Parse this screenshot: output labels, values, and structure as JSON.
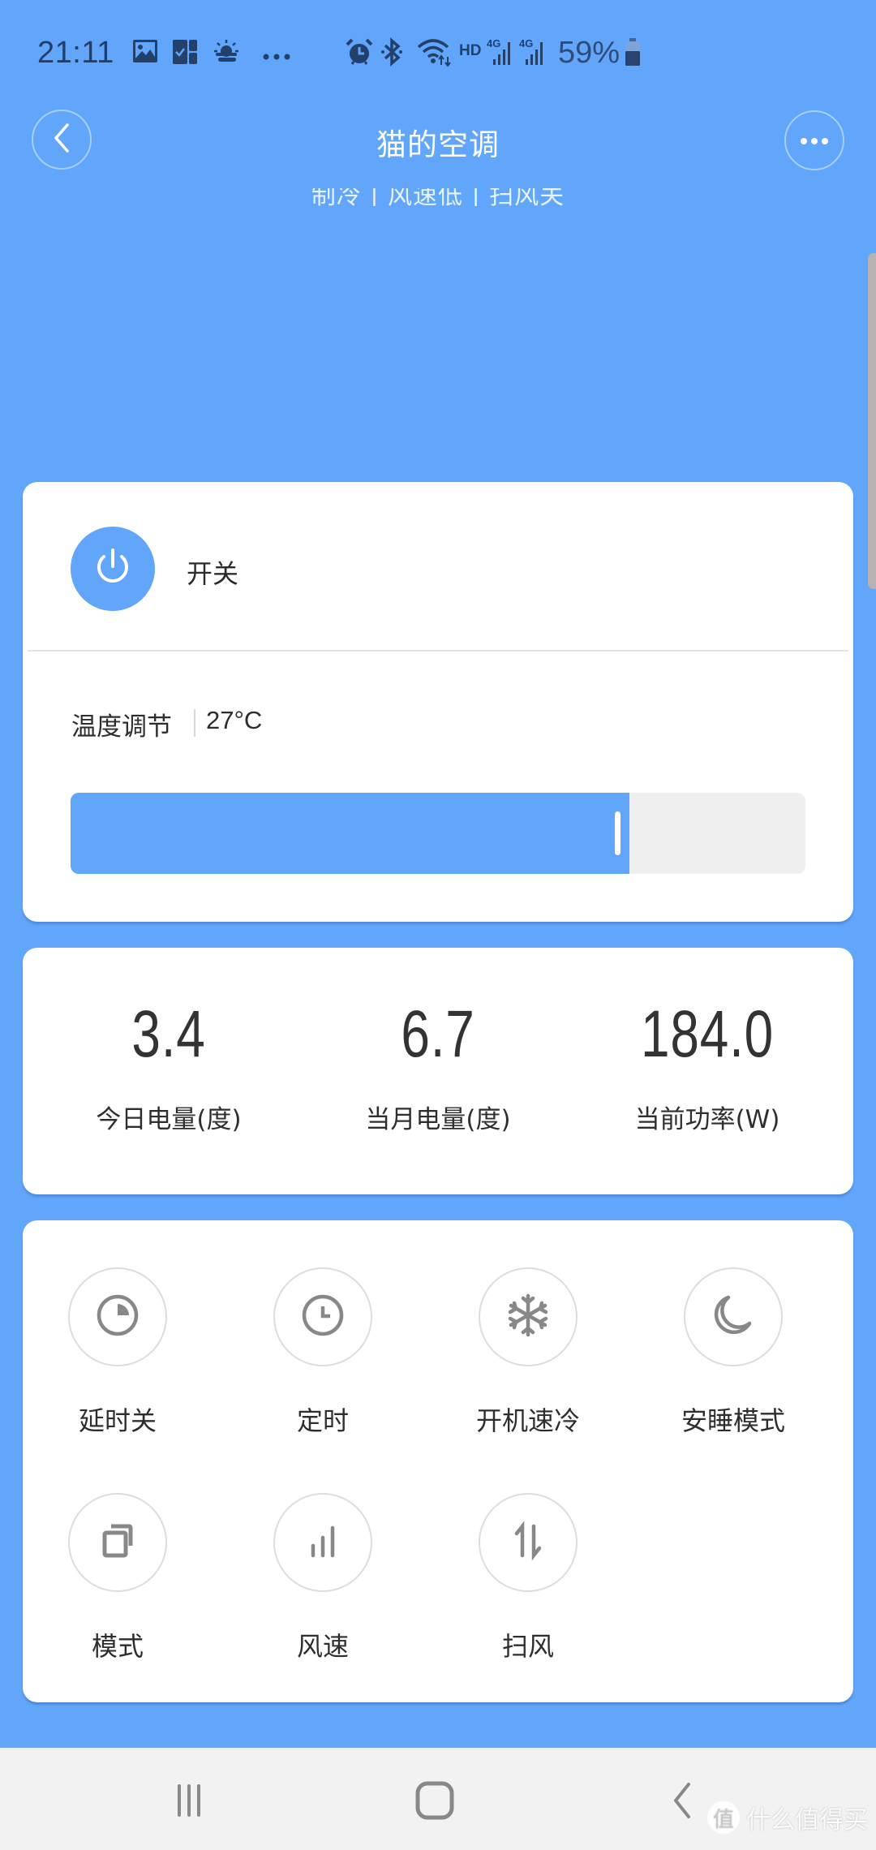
{
  "status_bar": {
    "time": "21:11",
    "left_icons": [
      "gallery-icon",
      "tasks-icon",
      "weather-icon",
      "more-dots-icon"
    ],
    "right_icons": [
      "alarm-icon",
      "bluetooth-icon",
      "wifi-icon",
      "hd-icon",
      "signal-4g-icon",
      "signal-4g-icon"
    ],
    "hd_label": "HD",
    "net_label": "4G",
    "battery_percent": "59%"
  },
  "header": {
    "title": "猫的空调",
    "subtitle": "制冷 | 风速低 | 扫风关",
    "back_icon": "chevron-left-icon",
    "more_icon": "more-horizontal-icon"
  },
  "control": {
    "power_label": "开关",
    "temperature_label": "温度调节",
    "temperature_value": "27°C",
    "slider_fraction": 0.76
  },
  "stats": [
    {
      "value": "3.4",
      "label": "今日电量(度)"
    },
    {
      "value": "6.7",
      "label": "当月电量(度)"
    },
    {
      "value": "184.0",
      "label": "当前功率(W)"
    }
  ],
  "functions": [
    {
      "label": "延时关",
      "icon": "delay-off-icon"
    },
    {
      "label": "定时",
      "icon": "clock-icon"
    },
    {
      "label": "开机速冷",
      "icon": "snowflake-icon"
    },
    {
      "label": "安睡模式",
      "icon": "moon-icon"
    },
    {
      "label": "模式",
      "icon": "mode-icon"
    },
    {
      "label": "风速",
      "icon": "fan-speed-icon"
    },
    {
      "label": "扫风",
      "icon": "swing-icon"
    }
  ],
  "nav_bar": {
    "recents_icon": "recents-icon",
    "home_icon": "home-icon",
    "back_icon": "back-icon"
  },
  "watermark": {
    "badge": "值",
    "text": "什么值得买"
  },
  "colors": {
    "accent": "#61a6fb",
    "card": "#ffffff",
    "icon_gray": "#888888",
    "nav_bg": "#f2f2f2"
  }
}
